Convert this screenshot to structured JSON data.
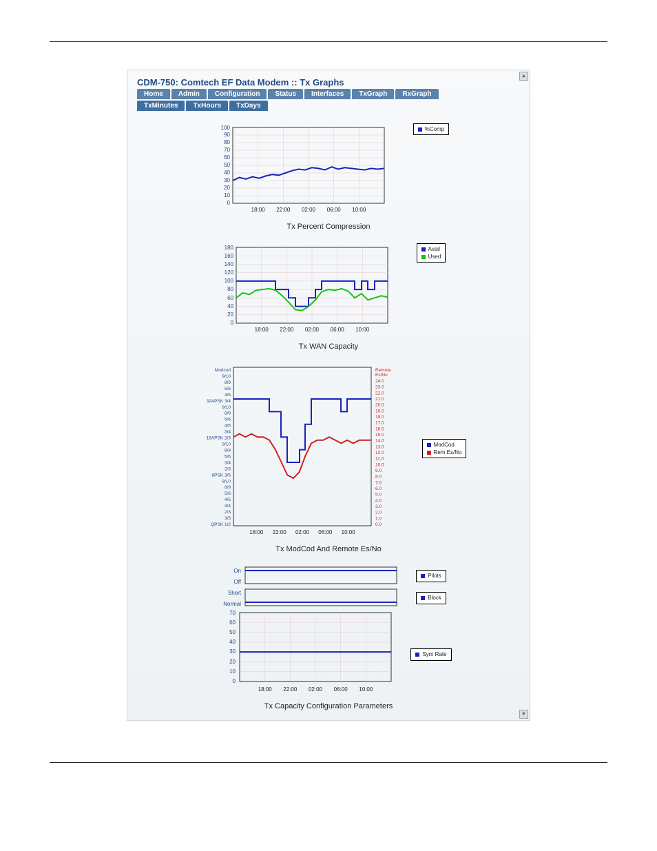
{
  "header_title": "CDM-750: Comtech EF Data Modem :: Tx Graphs",
  "tabs_main": [
    "Home",
    "Admin",
    "Configuration",
    "Status",
    "Interfaces",
    "TxGraph",
    "RxGraph"
  ],
  "tabs_sub": [
    "TxMinutes",
    "TxHours",
    "TxDays"
  ],
  "time_ticks": [
    "18:00",
    "22:00",
    "02:00",
    "06:00",
    "10:00"
  ],
  "chart_data": [
    {
      "type": "line",
      "title": "Tx Percent Compression",
      "xlabel": "",
      "ylabel": "",
      "ylim": [
        0,
        100
      ],
      "yticks": [
        0,
        10,
        20,
        30,
        40,
        50,
        60,
        70,
        80,
        90,
        100
      ],
      "x_tick_labels": [
        "18:00",
        "22:00",
        "02:00",
        "06:00",
        "10:00"
      ],
      "series": [
        {
          "name": "%Comp",
          "color": "#1a22bb",
          "x": [
            0,
            1,
            2,
            3,
            4,
            5,
            6,
            7,
            8,
            9,
            10,
            11,
            12,
            13,
            14,
            15,
            16,
            17,
            18,
            19,
            20,
            21,
            22,
            23
          ],
          "values": [
            30,
            34,
            32,
            35,
            33,
            36,
            38,
            37,
            40,
            43,
            45,
            44,
            47,
            46,
            44,
            48,
            45,
            47,
            46,
            45,
            44,
            46,
            45,
            46
          ]
        }
      ],
      "legend": [
        "%Comp"
      ]
    },
    {
      "type": "line",
      "title": "Tx WAN Capacity",
      "xlabel": "",
      "ylabel": "",
      "ylim": [
        0,
        180
      ],
      "yticks": [
        0,
        20,
        40,
        60,
        80,
        100,
        120,
        140,
        160,
        180
      ],
      "x_tick_labels": [
        "18:00",
        "22:00",
        "02:00",
        "06:00",
        "10:00"
      ],
      "series": [
        {
          "name": "Avail",
          "color": "#1a22bb",
          "x": [
            0,
            1,
            2,
            3,
            4,
            5,
            6,
            7,
            8,
            9,
            10,
            11,
            12,
            13,
            14,
            15,
            16,
            17,
            18,
            19,
            20,
            21,
            22,
            23
          ],
          "values": [
            100,
            100,
            100,
            100,
            100,
            100,
            100,
            80,
            60,
            40,
            40,
            60,
            80,
            100,
            100,
            100,
            100,
            100,
            80,
            100,
            80,
            100,
            100,
            100
          ]
        },
        {
          "name": "Used",
          "color": "#18c218",
          "x": [
            0,
            1,
            2,
            3,
            4,
            5,
            6,
            7,
            8,
            9,
            10,
            11,
            12,
            13,
            14,
            15,
            16,
            17,
            18,
            19,
            20,
            21,
            22,
            23
          ],
          "values": [
            60,
            72,
            68,
            78,
            80,
            82,
            78,
            65,
            48,
            32,
            30,
            40,
            55,
            75,
            80,
            78,
            82,
            76,
            60,
            70,
            55,
            60,
            65,
            62
          ]
        }
      ],
      "legend": [
        "Avail",
        "Used"
      ]
    },
    {
      "type": "line",
      "title": "Tx ModCod And Remote Es/No",
      "xlabel": "",
      "ylabel_left": "Modcod",
      "ylabel_right": "Remote Es/No",
      "y_left_labels": [
        "Modcod",
        "9/10",
        "8/9",
        "5/6",
        "4/5",
        "32APSK 3/4",
        "9/10",
        "8/9",
        "5/6",
        "4/5",
        "3/4",
        "16APSK 2/3",
        "9/10",
        "8/9",
        "5/6",
        "3/4",
        "2/3",
        "8PSK 3/5",
        "9/10",
        "8/9",
        "5/6",
        "4/5",
        "3/4",
        "2/3",
        "3/5",
        "QPSK 1/2"
      ],
      "y_right_labels": [
        "24.0",
        "23.0",
        "22.0",
        "21.0",
        "20.0",
        "19.0",
        "18.0",
        "17.0",
        "16.0",
        "15.0",
        "14.0",
        "13.0",
        "12.0",
        "11.0",
        "10.0",
        "9.0",
        "8.0",
        "7.0",
        "6.0",
        "5.0",
        "4.0",
        "3.0",
        "2.0",
        "1.0",
        "0.0"
      ],
      "x_tick_labels": [
        "18:00",
        "22:00",
        "02:00",
        "06:00",
        "10:00"
      ],
      "series": [
        {
          "name": "ModCod",
          "color": "#1a22bb",
          "x": [
            0,
            1,
            2,
            3,
            4,
            5,
            6,
            7,
            8,
            9,
            10,
            11,
            12,
            13,
            14,
            15,
            16,
            17,
            18,
            19,
            20,
            21,
            22,
            23
          ],
          "values": [
            20,
            20,
            20,
            20,
            20,
            20,
            20,
            18,
            14,
            10,
            10,
            12,
            16,
            20,
            20,
            20,
            20,
            20,
            18,
            20,
            20,
            20,
            20,
            20
          ]
        },
        {
          "name": "Rem Es/No",
          "color": "#d21f1f",
          "x": [
            0,
            1,
            2,
            3,
            4,
            5,
            6,
            7,
            8,
            9,
            10,
            11,
            12,
            13,
            14,
            15,
            16,
            17,
            18,
            19,
            20,
            21,
            22,
            23
          ],
          "values": [
            14,
            14.5,
            14,
            14.5,
            14,
            14,
            13.5,
            12,
            10,
            8,
            7.5,
            8.5,
            11,
            13,
            13.5,
            13.5,
            14,
            13.5,
            13,
            13.5,
            13,
            13.5,
            13.5,
            13.5
          ]
        }
      ],
      "legend": [
        "ModCod",
        "Rem Es/No"
      ]
    },
    {
      "type": "line",
      "title": "Tx Capacity Configuration Parameters",
      "xlabel": "",
      "ylabel": "",
      "x_tick_labels": [
        "18:00",
        "22:00",
        "02:00",
        "06:00",
        "10:00"
      ],
      "panels": [
        {
          "name": "Pilots",
          "y_labels": [
            "On",
            "Off"
          ],
          "value_label": "On",
          "series": {
            "color": "#1a22bb",
            "constant": "On"
          }
        },
        {
          "name": "Block",
          "y_labels": [
            "Short",
            "Normal"
          ],
          "value_label": "Normal",
          "series": {
            "color": "#1a22bb",
            "constant": "Normal"
          }
        },
        {
          "name": "Sym Rate",
          "yticks": [
            0,
            10,
            20,
            30,
            40,
            50,
            60,
            70
          ],
          "series": {
            "color": "#1a22bb",
            "constant": 30
          }
        }
      ],
      "legend": [
        "Pilots",
        "Block",
        "Sym Rate"
      ]
    }
  ],
  "legends": {
    "comp": "%Comp",
    "avail": "Avail",
    "used": "Used",
    "modcod": "ModCod",
    "remesno": "Rem Es/No",
    "pilots": "Pilots",
    "block": "Block",
    "symrate": "Sym Rate"
  },
  "titles": {
    "c1": "Tx Percent Compression",
    "c2": "Tx WAN Capacity",
    "c3": "Tx ModCod And Remote Es/No",
    "c4": "Tx Capacity Configuration Parameters"
  }
}
